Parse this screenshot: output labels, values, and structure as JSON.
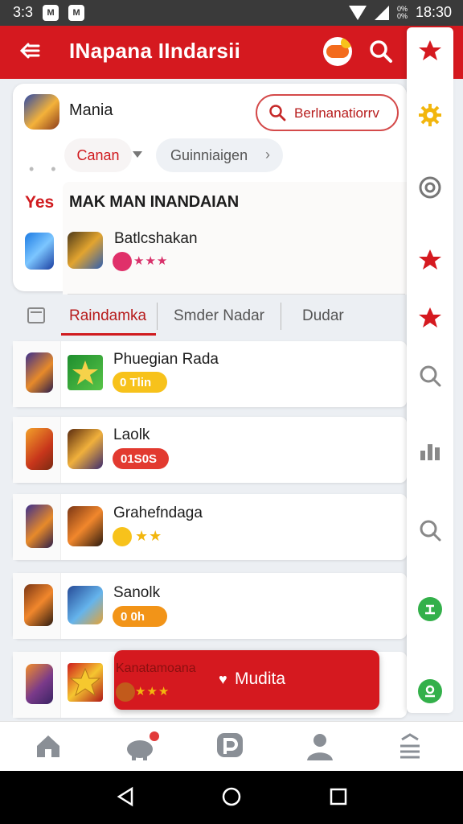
{
  "status_bar": {
    "left_text": "3:3",
    "icon1": "M",
    "icon2": "M",
    "battery_text": "0%\n0%",
    "time": "18:30"
  },
  "app_bar": {
    "title": "INapana IIndarsii",
    "back_icon": "arrow-left-icon",
    "search_icon": "search-icon"
  },
  "header": {
    "profile_name": "Mania",
    "search_pill": "Berlnanatiorrv",
    "chip_primary": "Canan",
    "chip_secondary": "Guinniaigen",
    "side_label": "Yes",
    "section_title": "MAK MAN INANDAIAN",
    "featured_title": "Batlcshakan",
    "featured_stars": "★★★"
  },
  "tabs": {
    "items": [
      "Raindamka",
      "Smder Nadar",
      "Dudar"
    ]
  },
  "rows": [
    {
      "title": "Phuegian Rada",
      "badge": "0 Tlin"
    },
    {
      "title": "Laolk",
      "badge": "01S0S"
    },
    {
      "title": "Grahefndaga",
      "stars": "★★"
    },
    {
      "title": "Sanolk",
      "badge": "0 0h"
    },
    {
      "title": "Kanatamoana",
      "stars": "★★★"
    }
  ],
  "fab": {
    "label": "Mudita"
  },
  "colors": {
    "brand_red": "#d5191f",
    "gold": "#f7c21b",
    "green": "#33b04a"
  },
  "rail_icons": [
    "star-icon",
    "gear-icon",
    "target-icon",
    "star-icon",
    "star-icon",
    "search-icon",
    "bars-icon",
    "search-icon",
    "leaderboard-icon",
    "profile-icon"
  ],
  "bottom_nav": [
    "home-icon",
    "piggy-bank-icon",
    "p-logo-icon",
    "person-icon",
    "menu-icon"
  ]
}
